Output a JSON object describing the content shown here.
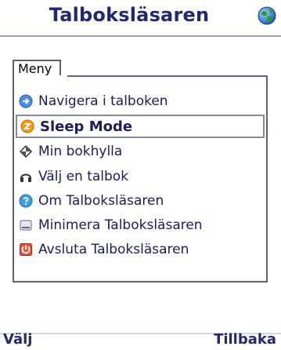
{
  "header": {
    "title": "Talboksläsaren",
    "status_icon": "globe-icon"
  },
  "menu": {
    "tab_label": "Meny",
    "items": [
      {
        "label": "Navigera i talboken",
        "icon": "blue-arrow-icon",
        "selected": false
      },
      {
        "label": "Sleep Mode",
        "icon": "orange-clock-icon",
        "selected": true
      },
      {
        "label": "Min bokhylla",
        "icon": "diamond-icon",
        "selected": false
      },
      {
        "label": "Välj en talbok",
        "icon": "headphones-icon",
        "selected": false
      },
      {
        "label": "Om Talboksläsaren",
        "icon": "help-icon",
        "selected": false
      },
      {
        "label": "Minimera Talboksläsaren",
        "icon": "minimize-icon",
        "selected": false
      },
      {
        "label": "Avsluta Talboksläsaren",
        "icon": "exit-icon",
        "selected": false
      }
    ]
  },
  "softkeys": {
    "left": "Välj",
    "right": "Tillbaka"
  },
  "colors": {
    "title": "#23286b",
    "text": "#1c1c58",
    "border": "#5f5f75"
  }
}
